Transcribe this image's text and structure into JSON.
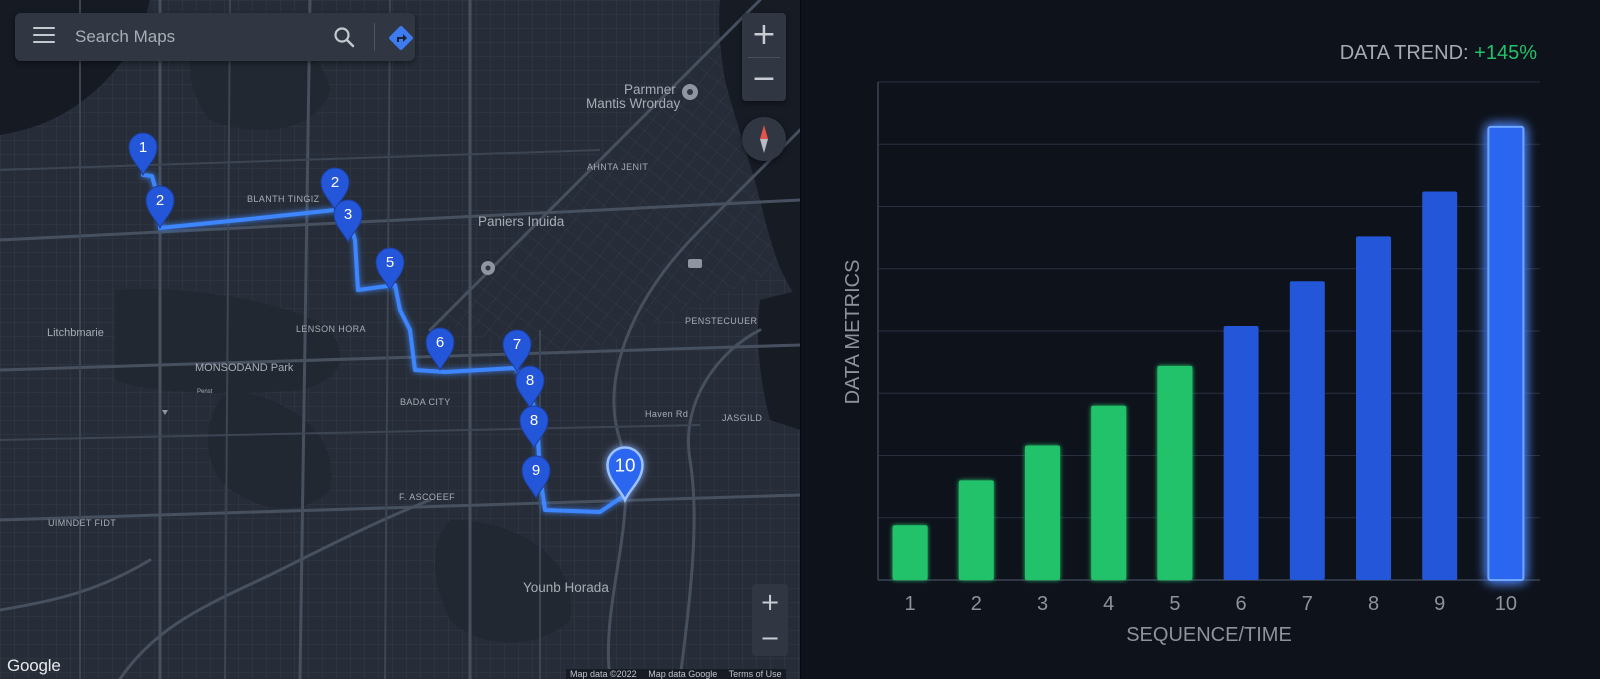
{
  "map": {
    "search": {
      "placeholder": "Search Maps"
    },
    "zoom": {
      "in": "+",
      "out": "−"
    },
    "labels": [
      {
        "text": "Parmner",
        "size": "big"
      },
      {
        "text": "Mantis Wrorday",
        "size": "big"
      },
      {
        "text": "AHNTA JENIT",
        "size": "small"
      },
      {
        "text": "BLANTH TINGIZ",
        "size": "small"
      },
      {
        "text": "Paniers Inuida",
        "size": "big"
      },
      {
        "text": "Litchbmarie",
        "size": "normal"
      },
      {
        "text": "LENSON HORA",
        "size": "small"
      },
      {
        "text": "MONSODAND Park",
        "size": "normal"
      },
      {
        "text": "PENSTECUUER",
        "size": "small"
      },
      {
        "text": "BADA CITY",
        "size": "small"
      },
      {
        "text": "Haven Rd",
        "size": "small"
      },
      {
        "text": "JASGILD",
        "size": "small"
      },
      {
        "text": "F. ASCOEEF",
        "size": "small"
      },
      {
        "text": "UIMNDET FIDT",
        "size": "small"
      },
      {
        "text": "Younb Horada",
        "size": "big"
      },
      {
        "text": "Penst",
        "size": "tiny"
      }
    ],
    "markers": [
      "1",
      "2",
      "2",
      "3",
      "5",
      "6",
      "7",
      "8",
      "8",
      "9",
      "10"
    ],
    "logo": "Google",
    "attribution": [
      "Map data ©2022",
      "Map data Google",
      "Terms of Use"
    ]
  },
  "chart": {
    "trend_label": "DATA TREND:",
    "trend_value": "+145%"
  },
  "colors": {
    "green": "#22c26a",
    "blue": "#2456d9",
    "highlight": "#3f7bff",
    "route": "#3d86ff"
  },
  "chart_data": {
    "type": "bar",
    "title": "",
    "xlabel": "SEQUENCE/TIME",
    "ylabel": "DATA METRICS",
    "categories": [
      "1",
      "2",
      "3",
      "4",
      "5",
      "6",
      "7",
      "8",
      "9",
      "10"
    ],
    "values": [
      11,
      20,
      27,
      35,
      43,
      51,
      60,
      69,
      78,
      91
    ],
    "bar_colors": [
      "green",
      "green",
      "green",
      "green",
      "green",
      "blue",
      "blue",
      "blue",
      "blue",
      "highlight"
    ],
    "ylim": [
      0,
      100
    ],
    "grid": true,
    "legend": "none"
  }
}
